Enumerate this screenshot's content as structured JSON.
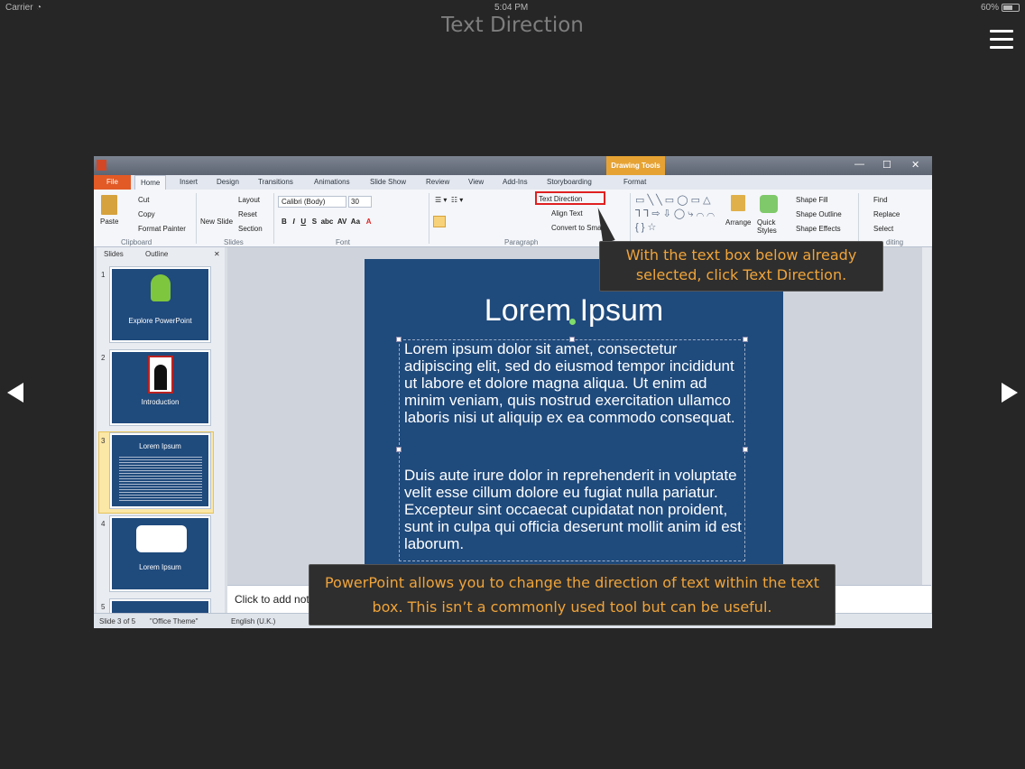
{
  "device": {
    "carrier": "Carrier",
    "time": "5:04 PM",
    "battery": "60%"
  },
  "lesson": {
    "title": "Text Direction"
  },
  "window": {
    "drawing_tools": "Drawing Tools"
  },
  "tabs": [
    "File",
    "Home",
    "Insert",
    "Design",
    "Transitions",
    "Animations",
    "Slide Show",
    "Review",
    "View",
    "Add-Ins",
    "Storyboarding",
    "Format"
  ],
  "ribbon": {
    "clipboard": {
      "paste": "Paste",
      "cut": "Cut",
      "copy": "Copy",
      "format_painter": "Format Painter",
      "group": "Clipboard"
    },
    "slides": {
      "new_slide": "New Slide",
      "layout": "Layout",
      "reset": "Reset",
      "section": "Section",
      "group": "Slides"
    },
    "font": {
      "name": "Calibri (Body)",
      "size": "30",
      "group": "Font"
    },
    "paragraph": {
      "text_direction": "Text Direction",
      "align_text": "Align Text",
      "convert": "Convert to Smar",
      "group": "Paragraph"
    },
    "drawing": {
      "arrange": "Arrange",
      "quick_styles": "Quick Styles",
      "shape_fill": "Shape Fill",
      "shape_outline": "Shape Outline",
      "shape_effects": "Shape Effects"
    },
    "editing": {
      "find": "Find",
      "replace": "Replace",
      "select": "Select",
      "group": "diting"
    }
  },
  "pane": {
    "tab_slides": "Slides",
    "tab_outline": "Outline",
    "thumbs": [
      {
        "num": "1",
        "title": "Explore PowerPoint"
      },
      {
        "num": "2",
        "title": "Introduction"
      },
      {
        "num": "3",
        "title": "Lorem Ipsum"
      },
      {
        "num": "4",
        "title": "Lorem Ipsum"
      },
      {
        "num": "5",
        "title": ""
      }
    ]
  },
  "slide": {
    "title": "Lorem Ipsum",
    "para1": "Lorem ipsum dolor sit amet, consectetur adipiscing elit, sed do eiusmod tempor incididunt ut labore et dolore magna aliqua. Ut enim ad minim veniam, quis nostrud exercitation ullamco laboris nisi ut aliquip ex ea commodo consequat.",
    "para2": "Duis aute irure dolor in reprehenderit in voluptate velit esse cillum dolore eu fugiat nulla pariatur. Excepteur sint occaecat cupidatat non proident, sunt in culpa qui officia deserunt mollit anim id est laborum."
  },
  "notes": {
    "placeholder": "Click to add note"
  },
  "status": {
    "slide": "Slide 3 of 5",
    "theme": "\"Office Theme\"",
    "lang": "English (U.K.)"
  },
  "callouts": {
    "top": "With the text box below already selected, click Text Direction.",
    "bottom": "PowerPoint allows you to change the direction of text within the text box. This isn’t a commonly used tool but can be useful."
  }
}
